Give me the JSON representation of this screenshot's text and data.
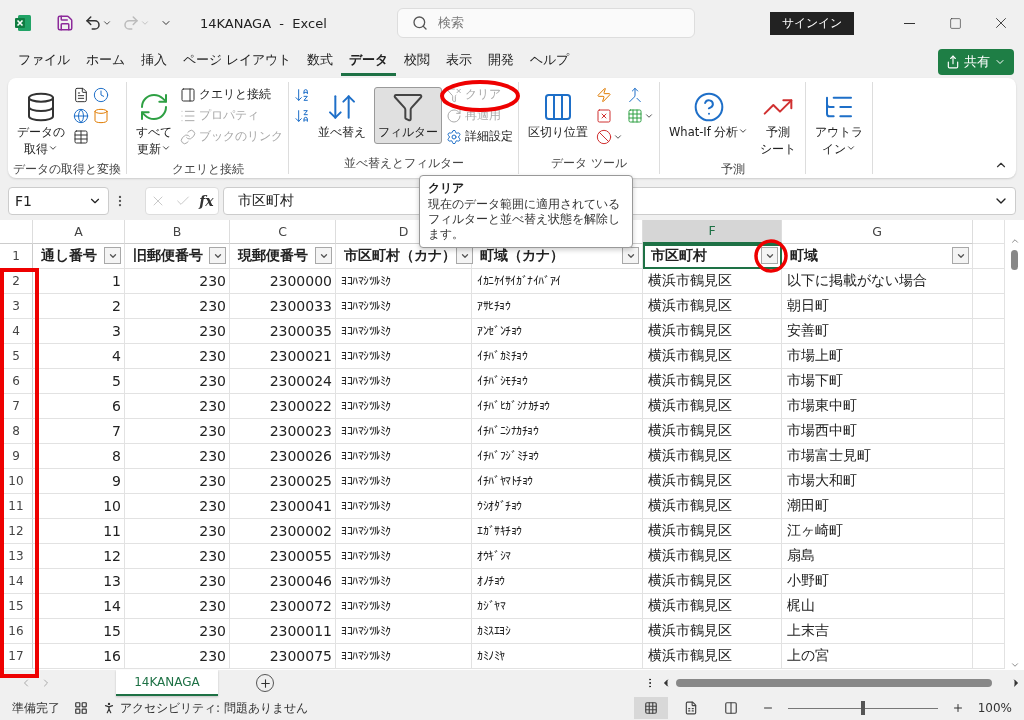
{
  "title_bar": {
    "title": "14KANAGA  -  Excel",
    "search_placeholder": "検索",
    "signin": "サインイン"
  },
  "menu_tabs": [
    {
      "label": "ファイル",
      "selected": false
    },
    {
      "label": "ホーム",
      "selected": false
    },
    {
      "label": "挿入",
      "selected": false
    },
    {
      "label": "ページ レイアウト",
      "selected": false
    },
    {
      "label": "数式",
      "selected": false
    },
    {
      "label": "データ",
      "selected": true
    },
    {
      "label": "校閲",
      "selected": false
    },
    {
      "label": "表示",
      "selected": false
    },
    {
      "label": "開発",
      "selected": false
    },
    {
      "label": "ヘルプ",
      "selected": false
    }
  ],
  "share_button": "共有",
  "ribbon_groups": [
    {
      "label": "データの取得と変換",
      "columns": [
        [
          {
            "kind": "large",
            "lines": [
              "データの",
              "取得"
            ],
            "dropdown": true,
            "pressed": false
          }
        ],
        [
          {
            "kind": "icon"
          },
          {
            "kind": "icon"
          },
          {
            "kind": "icon"
          }
        ],
        [
          {
            "kind": "icon"
          },
          {
            "kind": "icon"
          }
        ]
      ]
    },
    {
      "label": "クエリと接続",
      "columns": [
        [
          {
            "kind": "large",
            "lines": [
              "すべて",
              "更新"
            ],
            "dropdown": true,
            "pressed": false
          }
        ],
        [
          {
            "kind": "small",
            "label": "クエリと接続",
            "disabled": false
          },
          {
            "kind": "small",
            "label": "プロパティ",
            "disabled": true
          },
          {
            "kind": "small",
            "label": "ブックのリンク",
            "disabled": true
          }
        ]
      ]
    },
    {
      "label": "並べ替えとフィルター",
      "columns": [
        [
          {
            "kind": "icon"
          },
          {
            "kind": "icon"
          }
        ],
        [
          {
            "kind": "large",
            "lines": [
              "並べ替え"
            ],
            "pressed": false
          }
        ],
        [
          {
            "kind": "large",
            "lines": [
              "フィルター"
            ],
            "pressed": true
          }
        ],
        [
          {
            "kind": "small",
            "label": "クリア",
            "disabled": true
          },
          {
            "kind": "small",
            "label": "再適用",
            "disabled": true
          },
          {
            "kind": "small",
            "label": "詳細設定",
            "disabled": false
          }
        ]
      ]
    },
    {
      "label": "データ ツール",
      "columns": [
        [
          {
            "kind": "large",
            "lines": [
              "区切り位置"
            ],
            "pressed": false
          }
        ],
        [
          {
            "kind": "icon"
          },
          {
            "kind": "icon"
          },
          {
            "kind": "icon",
            "dropdown": true
          }
        ],
        [
          {
            "kind": "icon"
          },
          {
            "kind": "icon",
            "dropdown": true
          }
        ]
      ]
    },
    {
      "label": "予測",
      "columns": [
        [
          {
            "kind": "large",
            "lines": [
              "What-If 分析"
            ],
            "dropdown": true,
            "pressed": false
          }
        ],
        [
          {
            "kind": "large",
            "lines": [
              "予測",
              "シート"
            ],
            "pressed": false
          }
        ]
      ]
    },
    {
      "columns": [
        [
          {
            "kind": "large",
            "lines": [
              "アウトラ",
              "イン"
            ],
            "dropdown": true,
            "pressed": false
          }
        ]
      ]
    }
  ],
  "tooltip": {
    "title": "クリア",
    "body": "現在のデータ範囲に適用されているフィルターと並べ替え状態を解除します。"
  },
  "formula_bar": {
    "name_box": "F1",
    "function_button": "fx",
    "formula": "市区町村"
  },
  "columns": [
    {
      "letter": "A",
      "kind": "number",
      "selected": false
    },
    {
      "letter": "B",
      "kind": "number",
      "selected": false
    },
    {
      "letter": "C",
      "kind": "number",
      "selected": false
    },
    {
      "letter": "D",
      "kind": "kana",
      "selected": false
    },
    {
      "kind": "kana",
      "selected": false
    },
    {
      "letter": "F",
      "kind": "text",
      "selected": true
    },
    {
      "letter": "G",
      "kind": "text",
      "selected": false
    }
  ],
  "header_row": {
    "number": "1",
    "cells": [
      "通し番号",
      "旧郵便番号",
      "現郵便番号",
      "市区町村（カナ）",
      "町域（カナ）",
      "市区町村",
      "町域"
    ]
  },
  "rows": [
    {
      "number": "2",
      "cells": [
        "1",
        "230",
        "2300000",
        "ﾖｺﾊﾏｼﾂﾙﾐｸ",
        "ｲｶﾆｹｲｻｲｶﾞﾅｲﾊﾞｱｲ",
        "横浜市鶴見区",
        "以下に掲載がない場合"
      ]
    },
    {
      "number": "3",
      "cells": [
        "2",
        "230",
        "2300033",
        "ﾖｺﾊﾏｼﾂﾙﾐｸ",
        "ｱｻﾋﾁｮｳ",
        "横浜市鶴見区",
        "朝日町"
      ]
    },
    {
      "number": "4",
      "cells": [
        "3",
        "230",
        "2300035",
        "ﾖｺﾊﾏｼﾂﾙﾐｸ",
        "ｱﾝｾﾞﾝﾁｮｳ",
        "横浜市鶴見区",
        "安善町"
      ]
    },
    {
      "number": "5",
      "cells": [
        "4",
        "230",
        "2300021",
        "ﾖｺﾊﾏｼﾂﾙﾐｸ",
        "ｲﾁﾊﾞｶﾐﾁｮｳ",
        "横浜市鶴見区",
        "市場上町"
      ]
    },
    {
      "number": "6",
      "cells": [
        "5",
        "230",
        "2300024",
        "ﾖｺﾊﾏｼﾂﾙﾐｸ",
        "ｲﾁﾊﾞｼﾓﾁｮｳ",
        "横浜市鶴見区",
        "市場下町"
      ]
    },
    {
      "number": "7",
      "cells": [
        "6",
        "230",
        "2300022",
        "ﾖｺﾊﾏｼﾂﾙﾐｸ",
        "ｲﾁﾊﾞﾋｶﾞｼﾅｶﾁｮｳ",
        "横浜市鶴見区",
        "市場東中町"
      ]
    },
    {
      "number": "8",
      "cells": [
        "7",
        "230",
        "2300023",
        "ﾖｺﾊﾏｼﾂﾙﾐｸ",
        "ｲﾁﾊﾞﾆｼﾅｶﾁｮｳ",
        "横浜市鶴見区",
        "市場西中町"
      ]
    },
    {
      "number": "9",
      "cells": [
        "8",
        "230",
        "2300026",
        "ﾖｺﾊﾏｼﾂﾙﾐｸ",
        "ｲﾁﾊﾞﾌｼﾞﾐﾁｮｳ",
        "横浜市鶴見区",
        "市場富士見町"
      ]
    },
    {
      "number": "10",
      "cells": [
        "9",
        "230",
        "2300025",
        "ﾖｺﾊﾏｼﾂﾙﾐｸ",
        "ｲﾁﾊﾞﾔﾏﾄﾁｮｳ",
        "横浜市鶴見区",
        "市場大和町"
      ]
    },
    {
      "number": "11",
      "cells": [
        "10",
        "230",
        "2300041",
        "ﾖｺﾊﾏｼﾂﾙﾐｸ",
        "ｳｼｵﾀﾞﾁｮｳ",
        "横浜市鶴見区",
        "潮田町"
      ]
    },
    {
      "number": "12",
      "cells": [
        "11",
        "230",
        "2300002",
        "ﾖｺﾊﾏｼﾂﾙﾐｸ",
        "ｴｶﾞｻｷﾁｮｳ",
        "横浜市鶴見区",
        "江ヶ崎町"
      ]
    },
    {
      "number": "13",
      "cells": [
        "12",
        "230",
        "2300055",
        "ﾖｺﾊﾏｼﾂﾙﾐｸ",
        "ｵｳｷﾞｼﾏ",
        "横浜市鶴見区",
        "扇島"
      ]
    },
    {
      "number": "14",
      "cells": [
        "13",
        "230",
        "2300046",
        "ﾖｺﾊﾏｼﾂﾙﾐｸ",
        "ｵﾉﾁｮｳ",
        "横浜市鶴見区",
        "小野町"
      ]
    },
    {
      "number": "15",
      "cells": [
        "14",
        "230",
        "2300072",
        "ﾖｺﾊﾏｼﾂﾙﾐｸ",
        "ｶｼﾞﾔﾏ",
        "横浜市鶴見区",
        "梶山"
      ]
    },
    {
      "number": "16",
      "cells": [
        "15",
        "230",
        "2300011",
        "ﾖｺﾊﾏｼﾂﾙﾐｸ",
        "ｶﾐｽｴﾖｼ",
        "横浜市鶴見区",
        "上末吉"
      ]
    },
    {
      "number": "17",
      "cells": [
        "16",
        "230",
        "2300075",
        "ﾖｺﾊﾏｼﾂﾙﾐｸ",
        "ｶﾐﾉﾐﾔ",
        "横浜市鶴見区",
        "上の宮"
      ]
    }
  ],
  "sheet_tabs": [
    {
      "label": "14KANAGA",
      "selected": true
    }
  ],
  "status_bar": {
    "ready": "準備完了",
    "accessibility": "アクセシビリティ: 問題ありません",
    "views": [
      {
        "selected": true
      },
      {
        "selected": false
      },
      {
        "selected": false
      }
    ],
    "zoom": {
      "level": 0.5
    },
    "zoom_label": "100%"
  }
}
